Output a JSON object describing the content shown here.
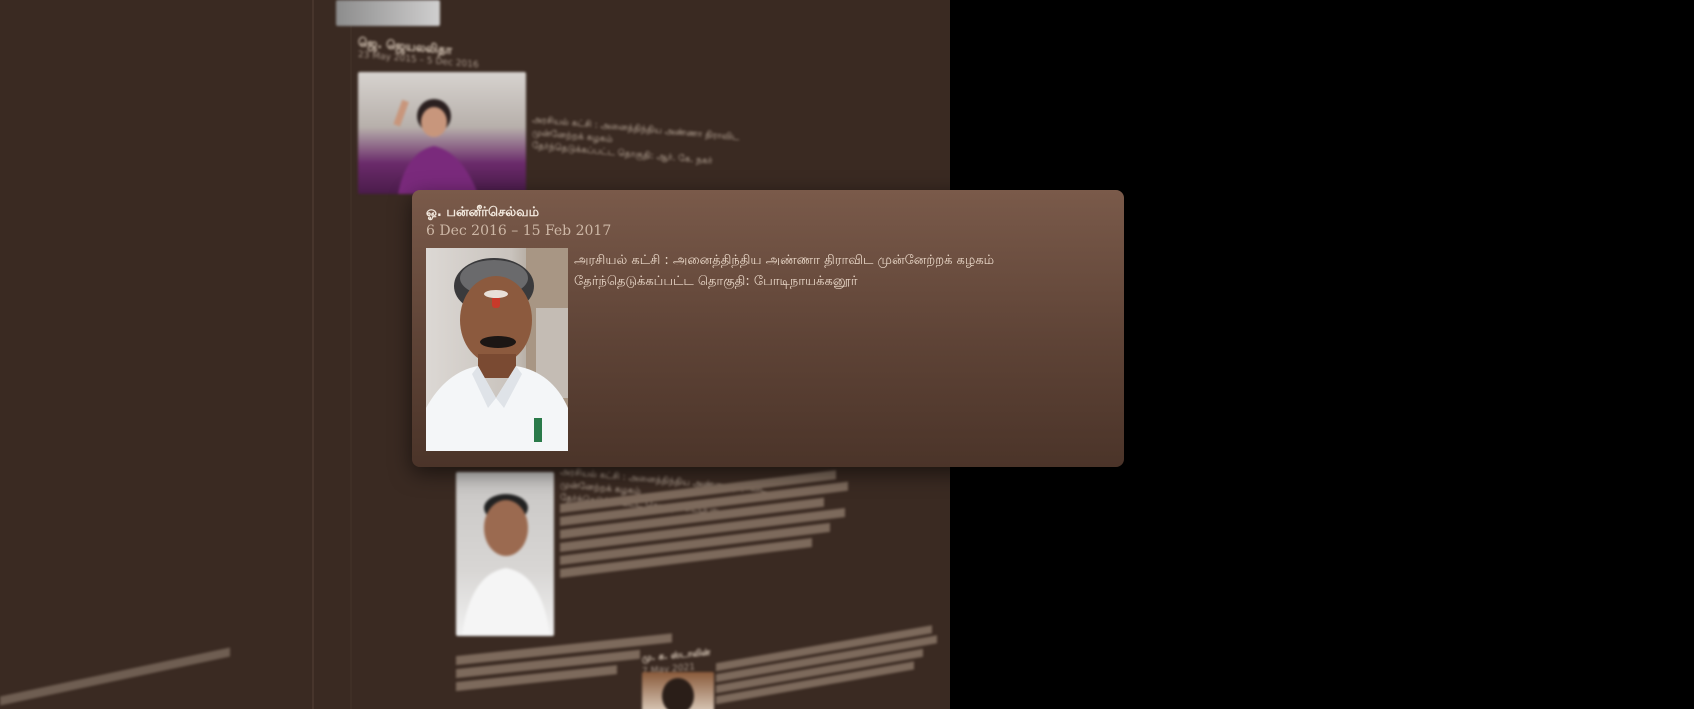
{
  "popup": {
    "name": "ஓ. பன்னீர்செல்வம்",
    "dates": "6 Dec 2016 – 15 Feb 2017",
    "party": "அரசியல் கட்சி : அனைத்திந்திய அண்ணா திராவிட முன்னேற்றக் கழகம்",
    "constituency": "தேர்ந்தெடுக்கப்பட்ட தொகுதி: போடிநாயக்கனூர்",
    "photo_icon": "portrait-photo"
  },
  "background": {
    "entry1": {
      "name": "ஜெ. ஜெயலலிதா",
      "dates": "23 May 2015 – 5 Dec 2016",
      "text1": "அரசியல் கட்சி : அனைத்திந்திய அண்ணா திராவிட முன்னேற்றக் கழகம்",
      "text2": "தேர்ந்தெடுக்கப்பட்ட தொகுதி: ஆர். கே. நகர்"
    },
    "entry2": {
      "text1": "அரசியல் கட்சி : அனைத்திந்திய அண்ணா திராவிட முன்னேற்றக் கழகம்",
      "text2": "தேர்ந்தெடுக்கப்பட்ட தொகுதி: எடப்பாடி",
      "para": "அதிமுகவின் தலைவர்...",
      "foot": "மேற்கொள்ளப்பட்ட பணிகள்..."
    },
    "entry3": {
      "name": "மு. க. ஸ்டாலின்",
      "dates": "7 May 2021"
    },
    "left_footer": "முதலமைச்சர் தேர்வு..."
  },
  "colors": {
    "page_bg": "#3a2a22",
    "popup_top": "#7a5a4a",
    "popup_bottom": "#4b3429"
  }
}
